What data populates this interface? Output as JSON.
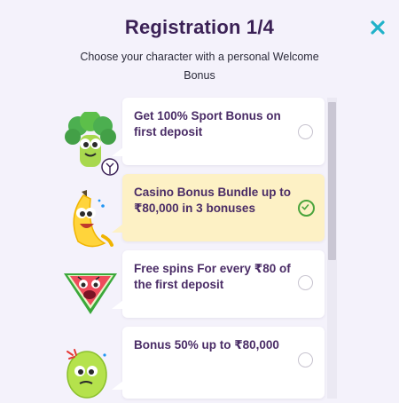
{
  "modal": {
    "title": "Registration 1/4",
    "subtitle": "Choose your character with a personal Welcome Bonus",
    "close_icon": "close-x-icon",
    "accent_color": "#20b2c9",
    "selected_background": "#fdf1c5",
    "check_color": "#4aa43c"
  },
  "options": [
    {
      "character": "broccoli-character",
      "text": "Get 100% Sport Bonus on first deposit",
      "selected": false
    },
    {
      "character": "banana-character",
      "text": "Casino Bonus Bundle up to ₹80,000 in 3 bonuses",
      "selected": true
    },
    {
      "character": "watermelon-character",
      "text": "Free spins For every ₹80 of the first deposit",
      "selected": false
    },
    {
      "character": "lemon-character",
      "text": "Bonus 50% up to ₹80,000",
      "selected": false
    }
  ]
}
